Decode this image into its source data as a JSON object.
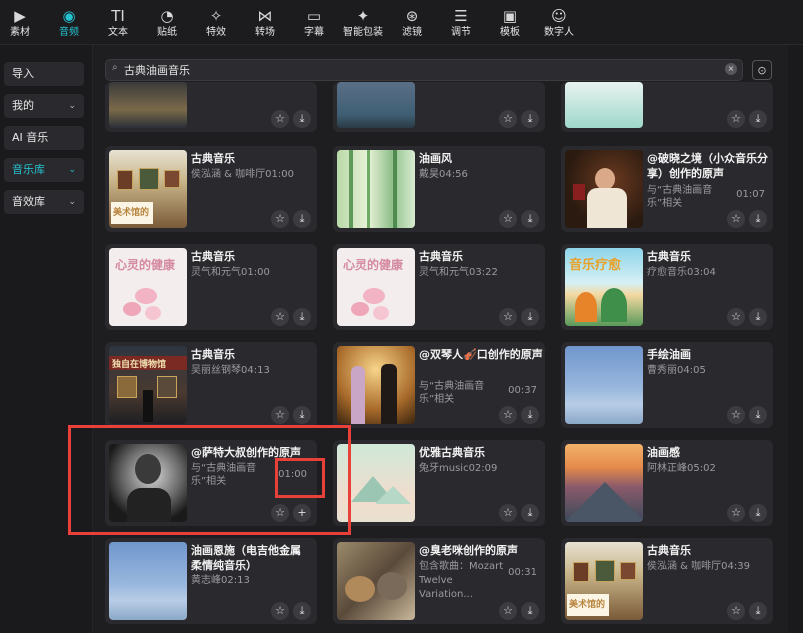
{
  "toolbar": {
    "items": [
      {
        "label": "素材",
        "icon": "media-icon",
        "glyph": "▶"
      },
      {
        "label": "音频",
        "icon": "audio-icon",
        "glyph": "◉"
      },
      {
        "label": "文本",
        "icon": "text-icon",
        "glyph": "TI"
      },
      {
        "label": "贴纸",
        "icon": "sticker-icon",
        "glyph": "◔"
      },
      {
        "label": "特效",
        "icon": "effects-icon",
        "glyph": "✧"
      },
      {
        "label": "转场",
        "icon": "transition-icon",
        "glyph": "⋈"
      },
      {
        "label": "字幕",
        "icon": "caption-icon",
        "glyph": "▭"
      },
      {
        "label": "智能包装",
        "icon": "smart-pack-icon",
        "glyph": "✦"
      },
      {
        "label": "滤镜",
        "icon": "filter-icon",
        "glyph": "⊛"
      },
      {
        "label": "调节",
        "icon": "adjust-icon",
        "glyph": "☰"
      },
      {
        "label": "模板",
        "icon": "template-icon",
        "glyph": "▣"
      },
      {
        "label": "数字人",
        "icon": "avatar-icon",
        "glyph": "☺"
      }
    ],
    "active": "音频"
  },
  "sidebar": {
    "items": [
      {
        "label": "导入",
        "chevron": ""
      },
      {
        "label": "我的",
        "chevron": "⌄"
      },
      {
        "label": "AI 音乐",
        "chevron": ""
      },
      {
        "label": "音乐库",
        "chevron": "⌄"
      },
      {
        "label": "音效库",
        "chevron": "⌄"
      }
    ],
    "active": "音乐库"
  },
  "search": {
    "value": "古典油画音乐",
    "clear_icon": "×",
    "filter_icon": "⊙"
  },
  "cards": [
    {
      "title": "古典音乐",
      "meta": "侯泓涵 & 咖啡厅01:00",
      "related": "",
      "duration": "",
      "thumb": "gallery"
    },
    {
      "title": "油画风",
      "meta": "戴昊04:56",
      "related": "",
      "duration": "",
      "thumb": "bamboo"
    },
    {
      "title": "@破晓之境（小众音乐分享）创作的原声",
      "meta": "",
      "related": "与“古典油画音乐”相关",
      "duration": "01:07",
      "thumb": "portrait"
    },
    {
      "title": "古典音乐",
      "meta": "灵气和元气01:00",
      "related": "",
      "duration": "",
      "thumb": "flower",
      "thumb_text": "心灵的健康"
    },
    {
      "title": "古典音乐",
      "meta": "灵气和元气03:22",
      "related": "",
      "duration": "",
      "thumb": "flower",
      "thumb_text": "心灵的健康"
    },
    {
      "title": "古典音乐",
      "meta": "疗愈音乐03:04",
      "related": "",
      "duration": "",
      "thumb": "therapy",
      "thumb_text": "音乐疗愈"
    },
    {
      "title": "古典音乐",
      "meta": "吴丽丝钢琴04:13",
      "related": "",
      "duration": "",
      "thumb": "museum",
      "thumb_text": "独自在博物馆"
    },
    {
      "title": "@双琴人🎻口创作的原声",
      "meta": "",
      "related": "与“古典油画音乐”相关",
      "duration": "00:37",
      "thumb": "musicians"
    },
    {
      "title": "手绘油画",
      "meta": "曹秀丽04:05",
      "related": "",
      "duration": "",
      "thumb": "sky"
    },
    {
      "title": "@萨特大叔创作的原声",
      "meta": "",
      "related": "与“古典油画音乐”相关",
      "duration": "01:00",
      "thumb": "bw"
    },
    {
      "title": "优雅古典音乐",
      "meta": "兔牙music02:09",
      "related": "",
      "duration": "",
      "thumb": "pastel"
    },
    {
      "title": "油画感",
      "meta": "阿林正峰05:02",
      "related": "",
      "duration": "",
      "thumb": "mountain"
    },
    {
      "title": "油画恩施（电吉他金属柔情纯音乐）",
      "meta": "黄志峰02:13",
      "related": "",
      "duration": "",
      "thumb": "sky"
    },
    {
      "title": "@臭老咪创作的原声",
      "meta": "包含歌曲：Mozart Twelve Variation...",
      "related": "",
      "duration": "00:31",
      "thumb": "cats"
    },
    {
      "title": "古典音乐",
      "meta": "侯泓涵 & 咖啡厅04:39",
      "related": "",
      "duration": "",
      "thumb": "gallery",
      "thumb_text": "美术馆的"
    }
  ],
  "gallery_text": "美术馆的",
  "icons": {
    "star": "☆",
    "download": "⤓",
    "add": "+"
  }
}
